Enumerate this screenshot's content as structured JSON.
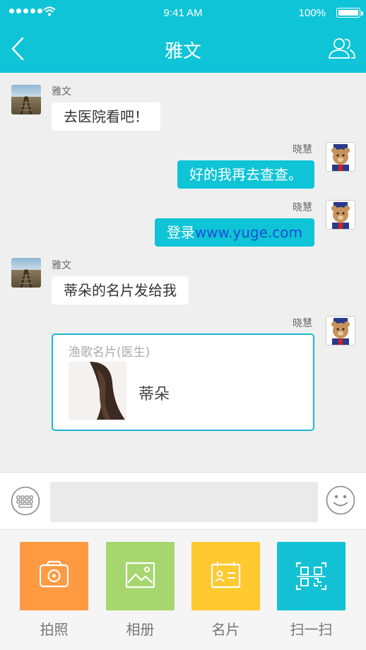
{
  "status_bar": {
    "time": "9:41 AM",
    "battery": "100%"
  },
  "header": {
    "title": "雅文"
  },
  "messages": [
    {
      "sender": "雅文",
      "text": "去医院看吧！"
    },
    {
      "sender": "晓慧",
      "text": "好的我再去查查。"
    },
    {
      "sender": "晓慧",
      "text_prefix": "登录",
      "link": "www.yuge.com"
    },
    {
      "sender": "雅文",
      "text": "蒂朵的名片发给我"
    },
    {
      "sender": "晓慧",
      "card": {
        "title": "渔歌名片(医生)",
        "name": "蒂朵"
      }
    }
  ],
  "input": {
    "placeholder": ""
  },
  "tools": [
    {
      "label": "拍照",
      "icon": "camera-icon",
      "color": "#ff9a43"
    },
    {
      "label": "相册",
      "icon": "image-icon",
      "color": "#a6d66e"
    },
    {
      "label": "名片",
      "icon": "card-icon",
      "color": "#ffc930"
    },
    {
      "label": "扫一扫",
      "icon": "qr-scan-icon",
      "color": "#12c2d4"
    }
  ],
  "colors": {
    "accent": "#0fc4d6",
    "link": "#1a4fd6"
  }
}
